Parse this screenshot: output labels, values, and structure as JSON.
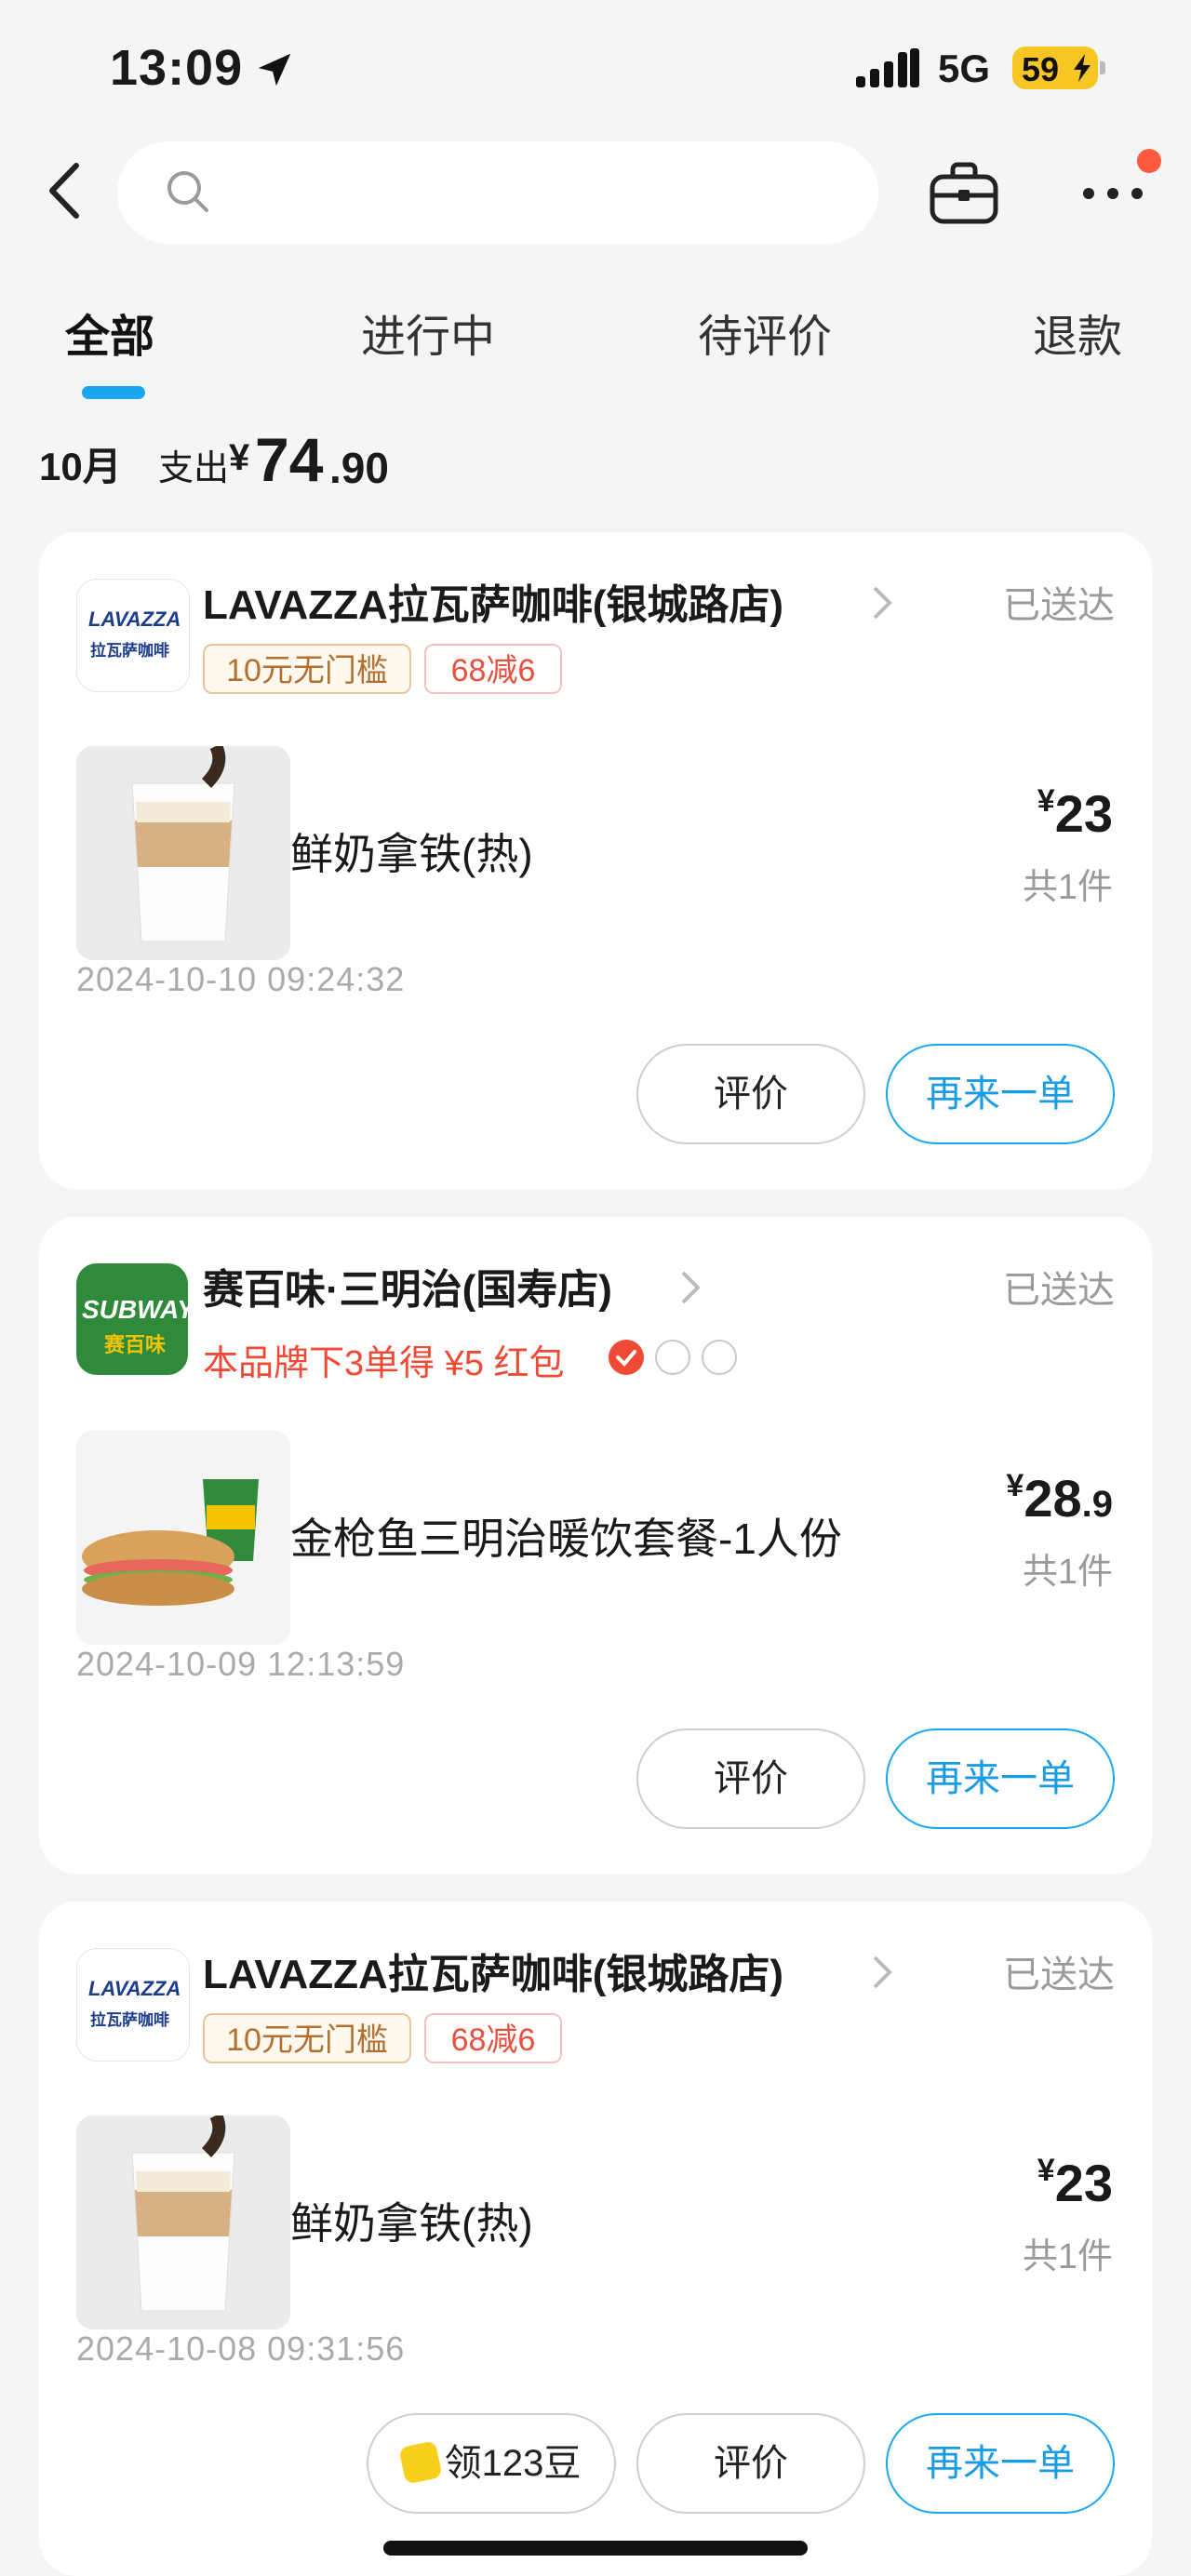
{
  "status_bar": {
    "time": "13:09",
    "network": "5G",
    "battery": "59"
  },
  "search": {
    "placeholder": ""
  },
  "tabs": [
    {
      "label": "全部",
      "active": true
    },
    {
      "label": "进行中",
      "active": false
    },
    {
      "label": "待评价",
      "active": false
    },
    {
      "label": "退款",
      "active": false
    }
  ],
  "summary": {
    "month": "10月",
    "label": "支出",
    "currency": "¥",
    "amount_int": "74",
    "amount_dec": ".90"
  },
  "orders": [
    {
      "store": "LAVAZZA拉瓦萨咖啡(银城路店)",
      "logo_text": "LAVAZZA",
      "logo_sub": "拉瓦萨咖啡",
      "status": "已送达",
      "tags": [
        "10元无门槛",
        "68减6"
      ],
      "item": "鲜奶拿铁(热)",
      "price_currency": "¥",
      "price_int": "23",
      "price_dec": "",
      "quantity": "共1件",
      "datetime": "2024-10-10 09:24:32",
      "buttons": {
        "rate": "评价",
        "reorder": "再来一单"
      }
    },
    {
      "store": "赛百味·三明治(国寿店)",
      "logo_text": "SUBWAY",
      "logo_sub": "赛百味",
      "status": "已送达",
      "promo": "本品牌下3单得 ¥5 红包",
      "promo_progress": {
        "done": 1,
        "total": 3
      },
      "item": "金枪鱼三明治暖饮套餐-1人份",
      "price_currency": "¥",
      "price_int": "28",
      "price_dec": ".9",
      "quantity": "共1件",
      "datetime": "2024-10-09 12:13:59",
      "buttons": {
        "rate": "评价",
        "reorder": "再来一单"
      }
    },
    {
      "store": "LAVAZZA拉瓦萨咖啡(银城路店)",
      "logo_text": "LAVAZZA",
      "logo_sub": "拉瓦萨咖啡",
      "status": "已送达",
      "tags": [
        "10元无门槛",
        "68减6"
      ],
      "item": "鲜奶拿铁(热)",
      "price_currency": "¥",
      "price_int": "23",
      "price_dec": "",
      "quantity": "共1件",
      "datetime": "2024-10-08 09:31:56",
      "buttons": {
        "beans": "领123豆",
        "rate": "评价",
        "reorder": "再来一单"
      }
    }
  ],
  "colors": {
    "accent": "#1aa7f0",
    "promo_red": "#f04a36",
    "brand_green": "#2f8a3c",
    "background": "#f3f5f7"
  }
}
